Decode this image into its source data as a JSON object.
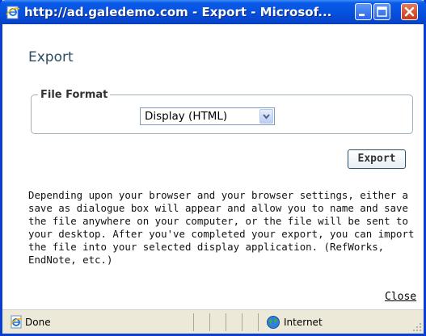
{
  "window": {
    "title": "http://ad.galedemo.com - Export - Microsof..."
  },
  "dialog": {
    "heading": "Export",
    "file_format_legend": "File Format",
    "format_select": {
      "selected": "Display (HTML)"
    },
    "export_button": "Export",
    "description": "Depending upon your browser and your browser settings, either a save as dialogue box will appear and allow you to name and save the file anywhere on your computer, or the file will be sent to your desktop. After you've completed your export, you can import the file into your selected display application. (RefWorks, EndNote, etc.)",
    "close_link": "Close"
  },
  "statusbar": {
    "status": "Done",
    "zone": "Internet"
  },
  "icons": {
    "title": "ie-page-icon",
    "minimize": "minimize-icon",
    "maximize": "maximize-icon",
    "close": "close-icon",
    "dropdown": "chevron-down-icon",
    "status": "ie-page-icon",
    "zone": "globe-icon"
  }
}
